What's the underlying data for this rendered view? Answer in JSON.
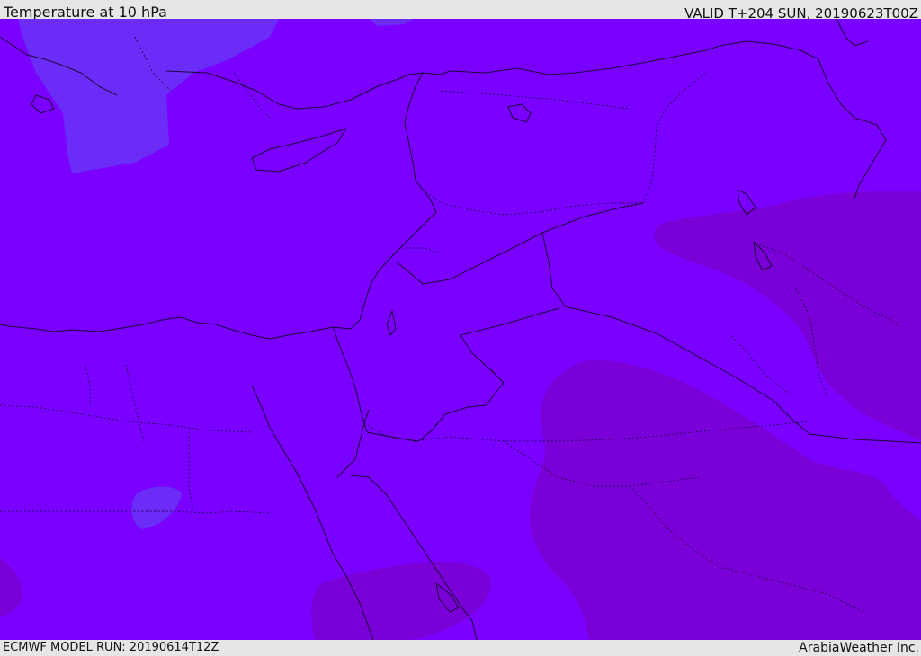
{
  "header": {
    "title": "Temperature at 10 hPa",
    "valid": "VALID T+204 SUN, 20190623T00Z"
  },
  "footer": {
    "model_run": "ECMWF MODEL RUN: 20190614T12Z",
    "credit": "ArabiaWeather Inc."
  },
  "map": {
    "colors": {
      "base_field": "#7a00ff",
      "cooler_field": "#6a2cf6",
      "warmer_field": "#7a00d8",
      "coastline": "#1c0a3a",
      "borders": "#240050"
    }
  }
}
